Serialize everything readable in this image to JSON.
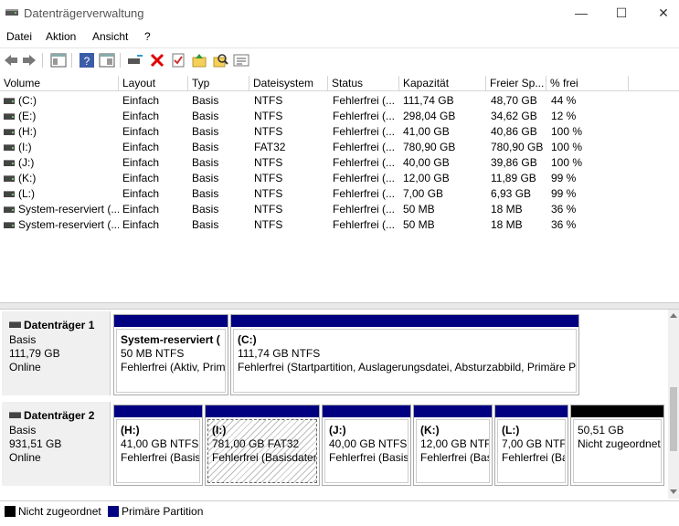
{
  "window": {
    "title": "Datenträgerverwaltung",
    "minimize": "—",
    "maximize": "☐",
    "close": "✕"
  },
  "menu": [
    "Datei",
    "Aktion",
    "Ansicht",
    "?"
  ],
  "columns": [
    "Volume",
    "Layout",
    "Typ",
    "Dateisystem",
    "Status",
    "Kapazität",
    "Freier Sp...",
    "% frei"
  ],
  "volumes": [
    [
      "(C:)",
      "Einfach",
      "Basis",
      "NTFS",
      "Fehlerfrei (...",
      "111,74 GB",
      "48,70 GB",
      "44 %"
    ],
    [
      "(E:)",
      "Einfach",
      "Basis",
      "NTFS",
      "Fehlerfrei (...",
      "298,04 GB",
      "34,62 GB",
      "12 %"
    ],
    [
      "(H:)",
      "Einfach",
      "Basis",
      "NTFS",
      "Fehlerfrei (...",
      "41,00 GB",
      "40,86 GB",
      "100 %"
    ],
    [
      "(I:)",
      "Einfach",
      "Basis",
      "FAT32",
      "Fehlerfrei (...",
      "780,90 GB",
      "780,90 GB",
      "100 %"
    ],
    [
      "(J:)",
      "Einfach",
      "Basis",
      "NTFS",
      "Fehlerfrei (...",
      "40,00 GB",
      "39,86 GB",
      "100 %"
    ],
    [
      "(K:)",
      "Einfach",
      "Basis",
      "NTFS",
      "Fehlerfrei (...",
      "12,00 GB",
      "11,89 GB",
      "99 %"
    ],
    [
      "(L:)",
      "Einfach",
      "Basis",
      "NTFS",
      "Fehlerfrei (...",
      "7,00 GB",
      "6,93 GB",
      "99 %"
    ],
    [
      "System-reserviert (...",
      "Einfach",
      "Basis",
      "NTFS",
      "Fehlerfrei (...",
      "50 MB",
      "18 MB",
      "36 %"
    ],
    [
      "System-reserviert (...",
      "Einfach",
      "Basis",
      "NTFS",
      "Fehlerfrei (...",
      "50 MB",
      "18 MB",
      "36 %"
    ]
  ],
  "disks": [
    {
      "name": "Datenträger 1",
      "type": "Basis",
      "size": "111,79 GB",
      "status": "Online",
      "partitions": [
        {
          "name": "System-reserviert  (",
          "size": "50 MB NTFS",
          "status": "Fehlerfrei (Aktiv, Prim"
        },
        {
          "name": "(C:)",
          "size": "111,74 GB NTFS",
          "status": "Fehlerfrei (Startpartition, Auslagerungsdatei, Absturzabbild, Primäre Pa"
        }
      ]
    },
    {
      "name": "Datenträger 2",
      "type": "Basis",
      "size": "931,51 GB",
      "status": "Online",
      "partitions": [
        {
          "name": "(H:)",
          "size": "41,00 GB NTFS",
          "status": "Fehlerfrei (Basis"
        },
        {
          "name": "(I:)",
          "size": "781,00 GB FAT32",
          "status": "Fehlerfrei (Basisdaten"
        },
        {
          "name": "(J:)",
          "size": "40,00 GB NTFS",
          "status": "Fehlerfrei (Basis"
        },
        {
          "name": "(K:)",
          "size": "12,00 GB NTFS",
          "status": "Fehlerfrei (Bas"
        },
        {
          "name": "(L:)",
          "size": "7,00 GB NTFS",
          "status": "Fehlerfrei (Ba"
        },
        {
          "name": "",
          "size": "50,51 GB",
          "status": "Nicht zugeordnet"
        }
      ]
    }
  ],
  "legend": [
    {
      "label": "Nicht zugeordnet",
      "color": "#000000"
    },
    {
      "label": "Primäre Partition",
      "color": "#000080"
    }
  ],
  "colors": {
    "primary": "#000080",
    "unallocated": "#000000",
    "delete": "#e00000"
  },
  "icons": [
    "back-icon",
    "forward-icon",
    "properties-icon",
    "help-icon",
    "console-icon",
    "connect-icon",
    "delete-icon",
    "check-icon",
    "import-icon",
    "search-icon",
    "list-icon"
  ]
}
